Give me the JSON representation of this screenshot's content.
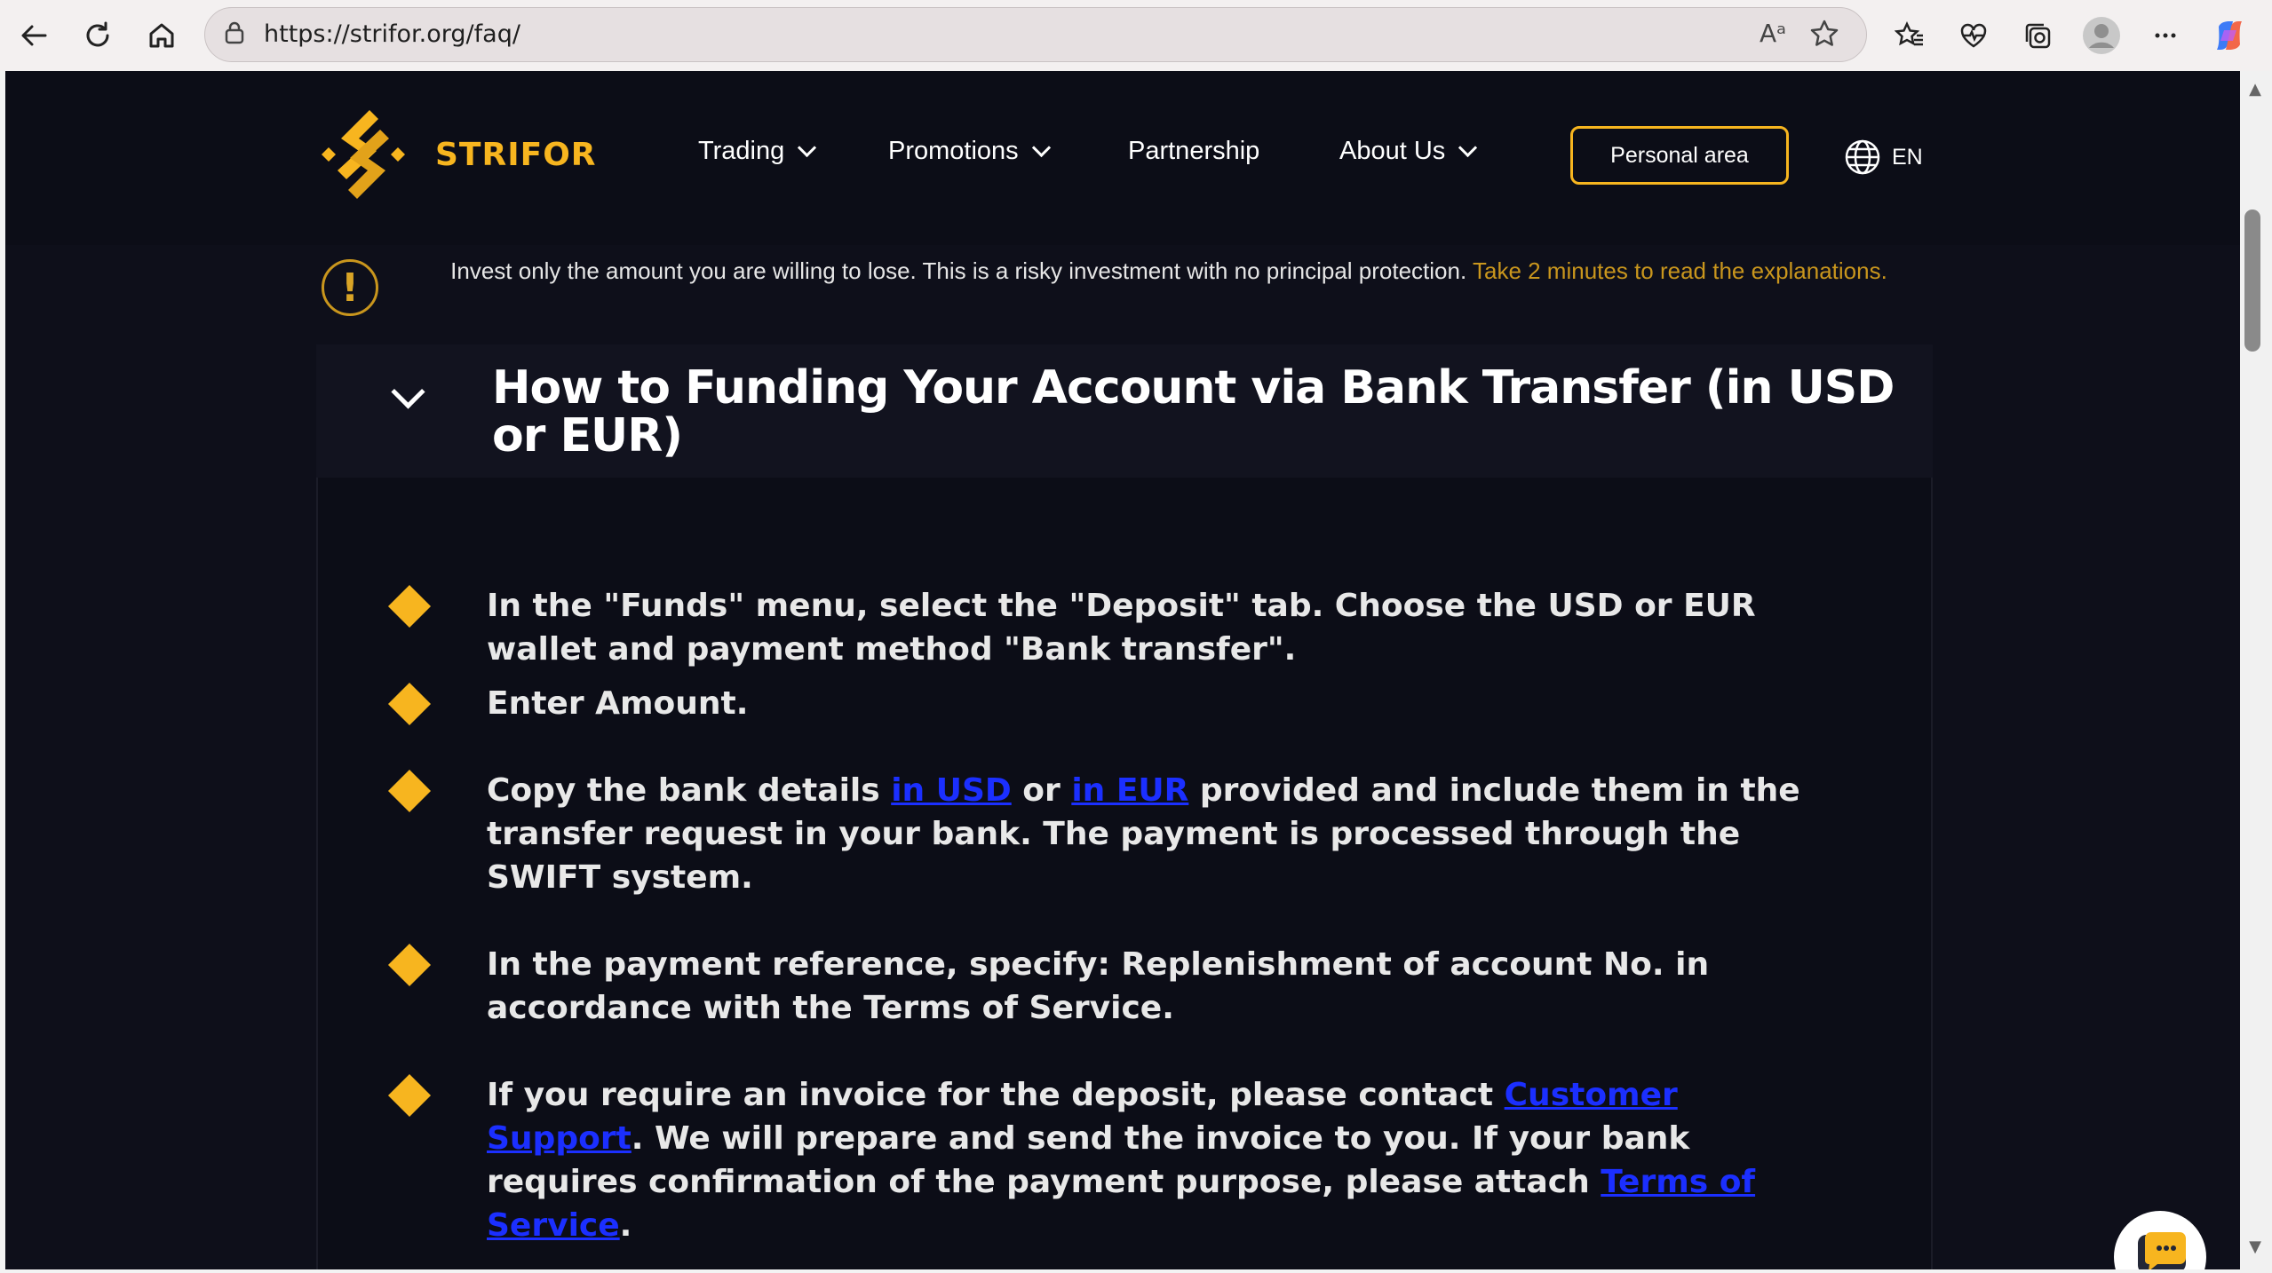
{
  "browser": {
    "url": "https://strifor.org/faq/",
    "read_aloud": "Aᵃ"
  },
  "site": {
    "logo_text": "STRIFOR",
    "menu": [
      {
        "label": "Trading",
        "dropdown": true
      },
      {
        "label": "Promotions",
        "dropdown": true
      },
      {
        "label": "Partnership",
        "dropdown": false
      },
      {
        "label": "About Us",
        "dropdown": true
      }
    ],
    "personal_area": "Personal area",
    "language": "EN"
  },
  "warning": {
    "text": "Invest only the amount you are willing to lose. This is a risky investment with no principal protection.",
    "link": "Take 2 minutes to read the explanations."
  },
  "faq": {
    "title": "How to Funding Your Account via Bank Transfer (in USD or EUR)",
    "steps": [
      {
        "text": "In the \"Funds\" menu, select the \"Deposit\" tab. Choose the USD or EUR wallet and payment method \"Bank transfer\"."
      },
      {
        "text": "Enter Amount."
      },
      {
        "part1": "Copy the bank details ",
        "link1": "in USD",
        "part2": " or ",
        "link2": "in EUR",
        "part3": " provided and include them in the transfer request in your bank. The payment is processed through the SWIFT system."
      },
      {
        "text": "In the payment reference, specify: Replenishment of account No. in accordance with the Terms of Service."
      },
      {
        "part1": "If you require an invoice for the deposit, please contact ",
        "link1": "Customer Support",
        "part2": ". We will prepare and send the invoice to you. If your bank requires confirmation of the payment purpose, please attach ",
        "link2": "Terms of Service",
        "part3": "."
      }
    ]
  },
  "colors": {
    "accent": "#f7b51f",
    "background": "#0c0d17",
    "link": "#1b2fff"
  }
}
